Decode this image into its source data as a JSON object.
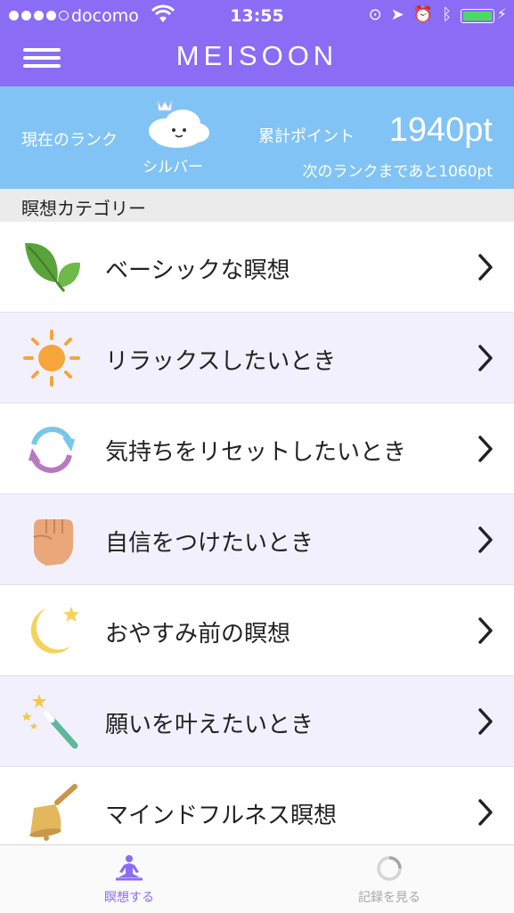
{
  "status_bar": {
    "carrier": "docomo",
    "time": "13:55"
  },
  "header": {
    "title": "MEISOON",
    "menu_icon": "hamburger-menu-icon"
  },
  "rank": {
    "current_rank_label": "現在のランク",
    "rank_name": "シルバー",
    "points_label": "累計ポイント",
    "points": "1940pt",
    "next_rank_text": "次のランクまであと1060pt"
  },
  "category_header": "瞑想カテゴリー",
  "categories": [
    {
      "label": "ベーシックな瞑想",
      "icon": "leaf-icon"
    },
    {
      "label": "リラックスしたいとき",
      "icon": "sun-icon"
    },
    {
      "label": "気持ちをリセットしたいとき",
      "icon": "refresh-icon"
    },
    {
      "label": "自信をつけたいとき",
      "icon": "fist-icon"
    },
    {
      "label": "おやすみ前の瞑想",
      "icon": "moon-icon"
    },
    {
      "label": "願いを叶えたいとき",
      "icon": "magic-wand-icon"
    },
    {
      "label": "マインドフルネス瞑想",
      "icon": "bell-icon"
    }
  ],
  "tabs": [
    {
      "label": "瞑想する",
      "icon": "meditation-icon",
      "active": true
    },
    {
      "label": "記録を見る",
      "icon": "loading-ring-icon",
      "active": false
    }
  ],
  "colors": {
    "header_purple": "#8a6cf5",
    "rank_blue": "#81c3f4",
    "alt_row": "#f3f0fd",
    "battery_green": "#4cd964"
  }
}
